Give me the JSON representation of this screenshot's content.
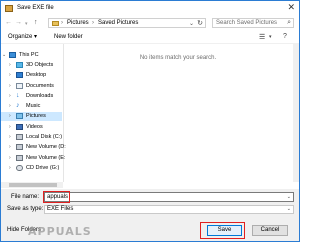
{
  "window": {
    "title": "Save EXE file"
  },
  "address_bar": {
    "crumbs": [
      "Pictures",
      "Saved Pictures"
    ],
    "search_placeholder": "Search Saved Pictures"
  },
  "toolbar": {
    "organize": "Organize ▾",
    "new_folder": "New folder"
  },
  "sidebar": {
    "items": [
      {
        "label": "This PC",
        "icon": "computer-icon"
      },
      {
        "label": "3D Objects",
        "icon": "3d-objects-icon"
      },
      {
        "label": "Desktop",
        "icon": "desktop-icon"
      },
      {
        "label": "Documents",
        "icon": "documents-icon"
      },
      {
        "label": "Downloads",
        "icon": "downloads-icon"
      },
      {
        "label": "Music",
        "icon": "music-icon"
      },
      {
        "label": "Pictures",
        "icon": "pictures-icon",
        "selected": true
      },
      {
        "label": "Videos",
        "icon": "videos-icon"
      },
      {
        "label": "Local Disk (C:)",
        "icon": "drive-icon"
      },
      {
        "label": "New Volume (D:",
        "icon": "drive-icon"
      },
      {
        "label": "New Volume (E:",
        "icon": "drive-icon"
      },
      {
        "label": "CD Drive (G:)",
        "icon": "cd-drive-icon"
      }
    ]
  },
  "content": {
    "empty_message": "No items match your search."
  },
  "form": {
    "file_name_label": "File name:",
    "file_name_value": "appuals",
    "save_type_label": "Save as type:",
    "save_type_value": "EXE Files",
    "hide_folders": "Hide Folders",
    "save": "Save",
    "cancel": "Cancel"
  },
  "watermark": "APPUALS",
  "colors": {
    "accent": "#0078d7",
    "highlight": "#e02020",
    "selection": "#cde8ff"
  }
}
